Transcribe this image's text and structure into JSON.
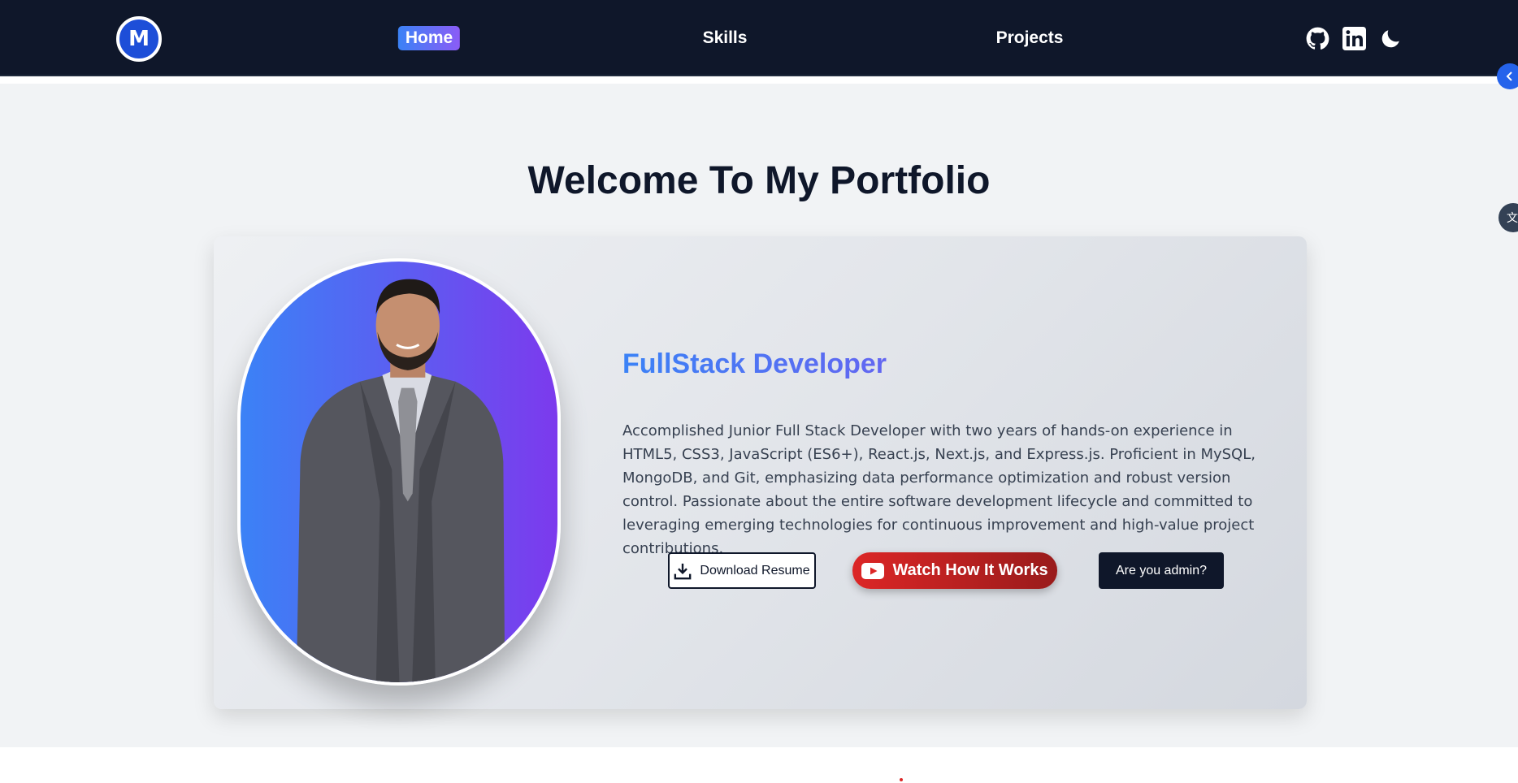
{
  "nav": {
    "logo_letter": "M",
    "links": [
      {
        "label": "Home",
        "active": true
      },
      {
        "label": "Skills",
        "active": false
      },
      {
        "label": "Projects",
        "active": false
      }
    ],
    "icons": [
      "github-icon",
      "linkedin-icon",
      "moon-icon"
    ]
  },
  "hero": {
    "heading": "Welcome To My Portfolio",
    "role": "FullStack Developer",
    "bio": "Accomplished Junior Full Stack Developer with two years of hands-on experience in HTML5, CSS3, JavaScript (ES6+), React.js, Next.js, and Express.js. Proficient in MySQL, MongoDB, and Git, emphasizing data performance optimization and robust version control. Passionate about the entire software development lifecycle and committed to leveraging emerging technologies for continuous improvement and high-value project contributions.",
    "buttons": {
      "download": "Download Resume",
      "watch": "Watch How It Works",
      "admin": "Are you admin?"
    }
  },
  "side": {
    "translate_glyph": "文"
  },
  "colors": {
    "navbar": "#0f172a",
    "accent_blue": "#3b82f6",
    "accent_purple": "#8b5cf6",
    "watch_red": "#dc2626",
    "hero_bg": "#f1f3f5"
  }
}
